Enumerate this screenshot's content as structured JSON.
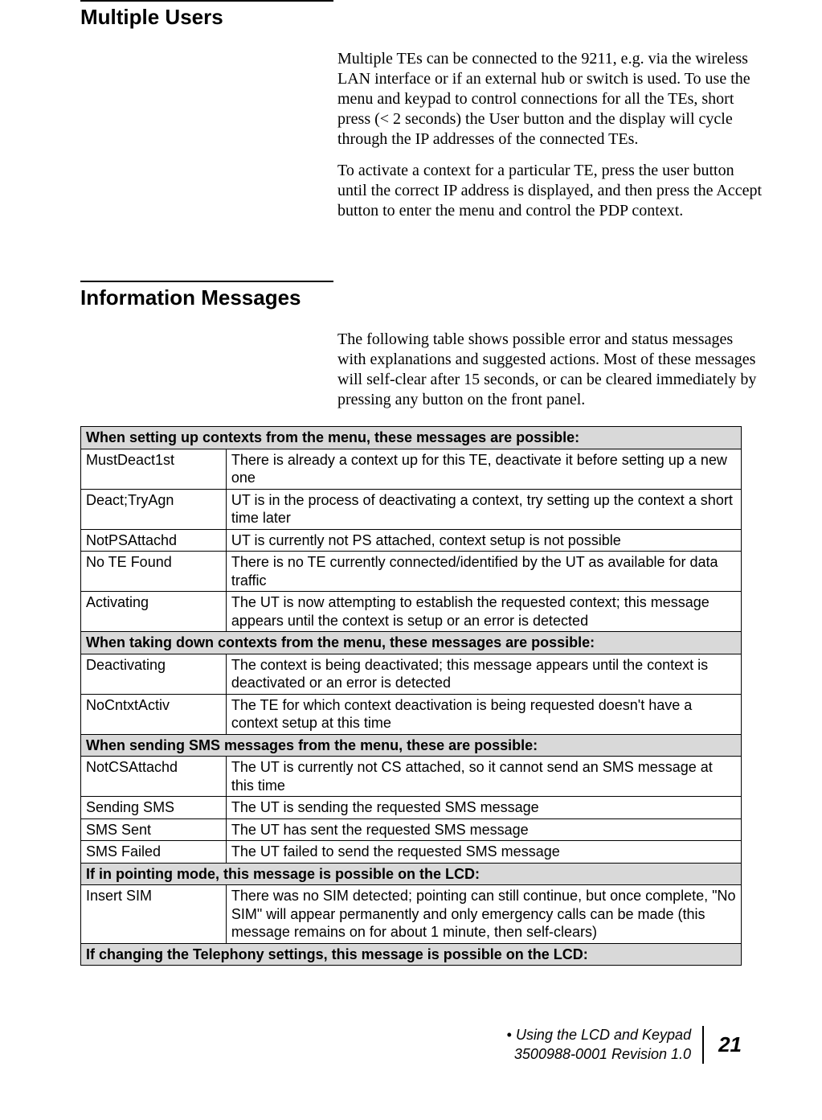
{
  "section1": {
    "title": "Multiple Users",
    "p1": "Multiple TEs can be connected to the 9211, e.g. via the wireless LAN interface or if an external hub or switch is used. To use the menu and keypad to control connections for all the TEs, short press (< 2 seconds) the User button and the display will cycle through the IP addresses of the connected TEs.",
    "p2": "To activate a context for a particular TE, press the user button until the correct IP address is displayed, and then press the Accept button to enter the menu and control the PDP context."
  },
  "section2": {
    "title": "Information Messages",
    "p1": "The following table shows possible error and status messages with explanations and suggested actions.  Most of these messages will self-clear after 15 seconds, or can be cleared immediately by pressing any button on the front panel."
  },
  "table": {
    "groups": [
      {
        "header": "When setting up contexts from the menu, these messages are possible:",
        "rows": [
          {
            "msg": "MustDeact1st",
            "desc": "There is already a context up for this TE, deactivate it before setting up a new one"
          },
          {
            "msg": "Deact;TryAgn",
            "desc": "UT is in the process of deactivating a context, try setting up the context a short time later"
          },
          {
            "msg": "NotPSAttachd",
            "desc": "UT is currently not PS attached, context setup is not possible"
          },
          {
            "msg": "No TE Found",
            "desc": "There is no TE currently connected/identified by the UT as available for data traffic"
          },
          {
            "msg": "Activating",
            "desc": "The UT is now attempting to establish the requested context; this message appears until the context is setup or an error is detected"
          }
        ]
      },
      {
        "header": "When taking down contexts from the menu, these messages are possible:",
        "rows": [
          {
            "msg": "Deactivating",
            "desc": "The context is being deactivated; this message appears until the context is deactivated or an error is detected"
          },
          {
            "msg": "NoCntxtActiv",
            "desc": "The TE for which context deactivation is being requested doesn't have a context setup at this time"
          }
        ]
      },
      {
        "header": "When sending SMS messages from the menu, these are possible:",
        "rows": [
          {
            "msg": "NotCSAttachd",
            "desc": "The UT is currently not CS attached, so it cannot send an SMS message at this time"
          },
          {
            "msg": "Sending SMS",
            "desc": "The UT is sending the requested SMS message"
          },
          {
            "msg": "SMS Sent",
            "desc": "The UT has sent the requested SMS message"
          },
          {
            "msg": "SMS Failed",
            "desc": "The UT failed to send the requested SMS message"
          }
        ]
      },
      {
        "header": "If in pointing mode, this message is possible on the LCD:",
        "rows": [
          {
            "msg": "Insert SIM",
            "desc": " There was no SIM detected; pointing can still continue, but once complete, \"No SIM\" will appear permanently and only emergency calls can be made (this message remains on for about 1 minute, then self-clears)"
          }
        ]
      },
      {
        "header": "If changing the Telephony settings, this message is possible on the LCD:",
        "rows": []
      }
    ]
  },
  "footer": {
    "bullet": "•",
    "line1": " Using the LCD and Keypad",
    "line2": "3500988-0001  Revision 1.0",
    "page": "21"
  }
}
